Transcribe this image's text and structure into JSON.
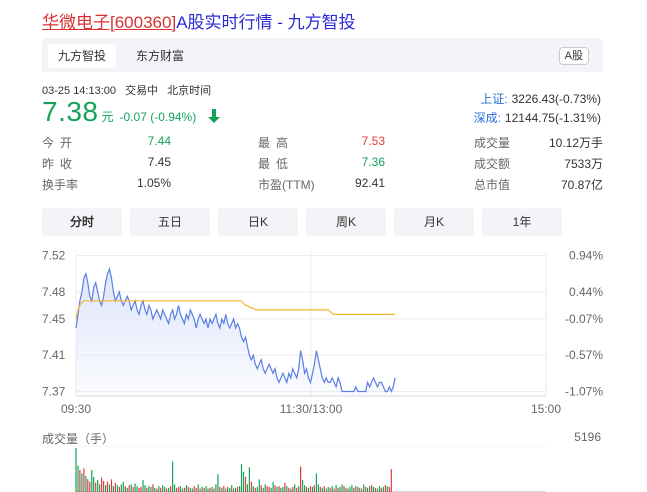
{
  "page_title": {
    "code_link": "华微电子[600360]",
    "rest": "A股实时行情 - 九方智投"
  },
  "tabs": [
    {
      "label": "九方智投",
      "active": true
    },
    {
      "label": "东方财富",
      "active": false
    }
  ],
  "market_badge": "A股",
  "quote_meta": {
    "datetime": "03-25 14:13:00",
    "status": "交易中",
    "timezone": "北京时间"
  },
  "price": {
    "value": "7.38",
    "unit": "元",
    "change": "-0.07 (-0.94%)",
    "direction": "down",
    "color": "#13a35b"
  },
  "indices": [
    {
      "name": "上证:",
      "value": "3226.43(-0.73%)"
    },
    {
      "name": "深成:",
      "value": "12144.75(-1.31%)"
    }
  ],
  "stats": [
    [
      {
        "label": "今开",
        "value": "7.44",
        "tone": "green",
        "tight": false
      },
      {
        "label": "最高",
        "value": "7.53",
        "tone": "red",
        "tight": false
      },
      {
        "label": "成交量",
        "value": "10.12万手",
        "tone": "dark",
        "tight": true
      }
    ],
    [
      {
        "label": "昨收",
        "value": "7.45",
        "tone": "dark",
        "tight": false
      },
      {
        "label": "最低",
        "value": "7.36",
        "tone": "green",
        "tight": false
      },
      {
        "label": "成交额",
        "value": "7533万",
        "tone": "dark",
        "tight": true
      }
    ],
    [
      {
        "label": "换手率",
        "value": "1.05%",
        "tone": "dark",
        "tight": true
      },
      {
        "label": "市盈(TTM)",
        "value": "92.41",
        "tone": "dark",
        "tight": true
      },
      {
        "label": "总市值",
        "value": "70.87亿",
        "tone": "dark",
        "tight": true
      }
    ]
  ],
  "periods": [
    {
      "label": "分时",
      "active": true
    },
    {
      "label": "五日",
      "active": false
    },
    {
      "label": "日K",
      "active": false
    },
    {
      "label": "周K",
      "active": false
    },
    {
      "label": "月K",
      "active": false
    },
    {
      "label": "1年",
      "active": false
    }
  ],
  "colors": {
    "up": "#e23b3b",
    "down": "#13a35b",
    "price_line": "#5b7ee5",
    "avg_line": "#f2b531",
    "area_fill": "#dfe6fb",
    "link": "#2b2bd6",
    "code_link": "#d93030"
  },
  "chart_data": {
    "type": "line",
    "x_ticks": [
      "09:30",
      "11:30/13:00",
      "15:00"
    ],
    "y_ticks": [
      "7.52",
      "7.48",
      "7.45",
      "7.41",
      "7.37"
    ],
    "y_tick_values": [
      7.52,
      7.48,
      7.45,
      7.41,
      7.37
    ],
    "pct_ticks": [
      "0.94%",
      "0.44%",
      "-0.07%",
      "-0.57%",
      "-1.07%"
    ],
    "ylim": [
      7.365,
      7.525
    ],
    "session_minutes": 240,
    "elapsed_minutes": 163,
    "prev_close": 7.45,
    "price": [
      7.44,
      7.455,
      7.47,
      7.48,
      7.495,
      7.5,
      7.49,
      7.475,
      7.47,
      7.485,
      7.49,
      7.48,
      7.47,
      7.465,
      7.475,
      7.49,
      7.5,
      7.505,
      7.495,
      7.48,
      7.47,
      7.475,
      7.48,
      7.47,
      7.465,
      7.47,
      7.475,
      7.47,
      7.46,
      7.465,
      7.47,
      7.46,
      7.455,
      7.465,
      7.47,
      7.46,
      7.455,
      7.465,
      7.46,
      7.45,
      7.455,
      7.46,
      7.455,
      7.45,
      7.46,
      7.455,
      7.45,
      7.445,
      7.455,
      7.46,
      7.45,
      7.455,
      7.465,
      7.455,
      7.45,
      7.445,
      7.455,
      7.45,
      7.46,
      7.455,
      7.45,
      7.44,
      7.45,
      7.455,
      7.45,
      7.445,
      7.45,
      7.44,
      7.45,
      7.445,
      7.45,
      7.455,
      7.445,
      7.44,
      7.45,
      7.445,
      7.455,
      7.445,
      7.44,
      7.445,
      7.45,
      7.44,
      7.445,
      7.44,
      7.43,
      7.425,
      7.43,
      7.42,
      7.41,
      7.405,
      7.41,
      7.4,
      7.395,
      7.4,
      7.405,
      7.395,
      7.39,
      7.395,
      7.4,
      7.395,
      7.39,
      7.395,
      7.385,
      7.38,
      7.385,
      7.39,
      7.385,
      7.38,
      7.39,
      7.385,
      7.395,
      7.39,
      7.385,
      7.395,
      7.415,
      7.405,
      7.39,
      7.395,
      7.385,
      7.38,
      7.39,
      7.4,
      7.415,
      7.405,
      7.395,
      7.385,
      7.38,
      7.385,
      7.38,
      7.38,
      7.385,
      7.38,
      7.375,
      7.385,
      7.38,
      7.37,
      7.37,
      7.37,
      7.37,
      7.37,
      7.37,
      7.37,
      7.375,
      7.37,
      7.37,
      7.37,
      7.37,
      7.37,
      7.38,
      7.375,
      7.38,
      7.385,
      7.38,
      7.375,
      7.38,
      7.38,
      7.375,
      7.37,
      7.37,
      7.375,
      7.37,
      7.375,
      7.385
    ],
    "average": [
      7.45,
      7.46,
      7.465,
      7.468,
      7.47,
      7.47,
      7.47,
      7.47,
      7.47,
      7.47,
      7.47,
      7.47,
      7.47,
      7.47,
      7.47,
      7.47,
      7.47,
      7.47,
      7.47,
      7.47,
      7.47,
      7.47,
      7.47,
      7.47,
      7.47,
      7.47,
      7.47,
      7.47,
      7.47,
      7.47,
      7.47,
      7.47,
      7.47,
      7.47,
      7.47,
      7.47,
      7.47,
      7.47,
      7.47,
      7.47,
      7.47,
      7.47,
      7.47,
      7.47,
      7.47,
      7.47,
      7.47,
      7.47,
      7.47,
      7.47,
      7.47,
      7.47,
      7.47,
      7.47,
      7.47,
      7.47,
      7.47,
      7.47,
      7.47,
      7.47,
      7.47,
      7.47,
      7.47,
      7.47,
      7.47,
      7.47,
      7.47,
      7.47,
      7.47,
      7.47,
      7.47,
      7.47,
      7.47,
      7.47,
      7.47,
      7.47,
      7.47,
      7.47,
      7.47,
      7.47,
      7.47,
      7.47,
      7.47,
      7.47,
      7.47,
      7.467,
      7.465,
      7.465,
      7.463,
      7.462,
      7.462,
      7.46,
      7.46,
      7.46,
      7.46,
      7.46,
      7.46,
      7.46,
      7.46,
      7.46,
      7.46,
      7.46,
      7.46,
      7.46,
      7.46,
      7.46,
      7.46,
      7.46,
      7.46,
      7.46,
      7.46,
      7.46,
      7.46,
      7.46,
      7.46,
      7.46,
      7.46,
      7.46,
      7.46,
      7.46,
      7.46,
      7.46,
      7.46,
      7.46,
      7.46,
      7.46,
      7.46,
      7.46,
      7.46,
      7.458,
      7.456,
      7.455,
      7.455,
      7.455,
      7.455,
      7.455,
      7.455,
      7.455,
      7.455,
      7.455,
      7.455,
      7.455,
      7.455,
      7.455,
      7.455,
      7.455,
      7.455,
      7.455,
      7.455,
      7.455,
      7.455,
      7.455,
      7.455,
      7.455,
      7.455,
      7.455,
      7.455,
      7.455,
      7.455,
      7.455,
      7.455,
      7.455,
      7.455
    ],
    "volume_label": "成交量（手）",
    "volume_max": "5196",
    "volume_max_value": 5196,
    "volume": [
      5196,
      3100,
      2600,
      2200,
      2800,
      1900,
      1500,
      1200,
      2600,
      1800,
      1100,
      1400,
      900,
      1700,
      1300,
      800,
      1200,
      900,
      1500,
      700,
      1100,
      800,
      600,
      900,
      1200,
      700,
      500,
      800,
      900,
      600,
      1000,
      700,
      500,
      600,
      1400,
      800,
      500,
      700,
      600,
      900,
      500,
      400,
      700,
      500,
      800,
      600,
      400,
      500,
      700,
      3600,
      900,
      500,
      600,
      700,
      400,
      500,
      800,
      600,
      500,
      400,
      700,
      500,
      900,
      400,
      600,
      500,
      700,
      400,
      500,
      600,
      400,
      900,
      2100,
      600,
      500,
      700,
      400,
      600,
      500,
      800,
      400,
      500,
      600,
      700,
      3300,
      2400,
      1800,
      900,
      2900,
      1200,
      700,
      500,
      600,
      1500,
      800,
      500,
      900,
      700,
      600,
      500,
      1200,
      800,
      600,
      700,
      500,
      600,
      1100,
      700,
      500,
      400,
      600,
      900,
      500,
      700,
      3000,
      1400,
      800,
      600,
      500,
      700,
      600,
      800,
      2200,
      900,
      600,
      500,
      700,
      400,
      600,
      500,
      700,
      400,
      800,
      500,
      600,
      900,
      700,
      500,
      400,
      600,
      800,
      500,
      700,
      600,
      500,
      400,
      900,
      600,
      500,
      700,
      800,
      600,
      500,
      400,
      700,
      500,
      600,
      800,
      700,
      600,
      2700
    ],
    "volume_dir": [
      "d",
      "d",
      "u",
      "d",
      "u",
      "d",
      "u",
      "u",
      "d",
      "d",
      "u",
      "d",
      "d",
      "u",
      "u",
      "d",
      "u",
      "d",
      "u",
      "d",
      "u",
      "d",
      "u",
      "d",
      "d",
      "u",
      "d",
      "u",
      "d",
      "u",
      "d",
      "d",
      "u",
      "u",
      "d",
      "d",
      "u",
      "d",
      "d",
      "u",
      "d",
      "u",
      "d",
      "u",
      "d",
      "d",
      "u",
      "d",
      "u",
      "d",
      "d",
      "u",
      "u",
      "d",
      "d",
      "u",
      "d",
      "u",
      "d",
      "d",
      "u",
      "u",
      "d",
      "u",
      "d",
      "u",
      "d",
      "d",
      "u",
      "d",
      "u",
      "d",
      "d",
      "u",
      "d",
      "u",
      "d",
      "u",
      "d",
      "d",
      "u",
      "d",
      "u",
      "d",
      "d",
      "d",
      "u",
      "d",
      "d",
      "u",
      "d",
      "u",
      "d",
      "d",
      "u",
      "d",
      "d",
      "u",
      "u",
      "d",
      "d",
      "u",
      "d",
      "u",
      "d",
      "d",
      "u",
      "d",
      "u",
      "d",
      "u",
      "d",
      "u",
      "d",
      "u",
      "d",
      "d",
      "u",
      "d",
      "u",
      "d",
      "u",
      "d",
      "d",
      "u",
      "d",
      "u",
      "d",
      "d",
      "u",
      "d",
      "u",
      "d",
      "u",
      "d",
      "d",
      "u",
      "d",
      "u",
      "d",
      "d",
      "u",
      "d",
      "u",
      "d",
      "u",
      "d",
      "d",
      "u",
      "d",
      "u",
      "d",
      "u",
      "d",
      "d",
      "u",
      "d",
      "u",
      "d",
      "u",
      "u"
    ]
  }
}
